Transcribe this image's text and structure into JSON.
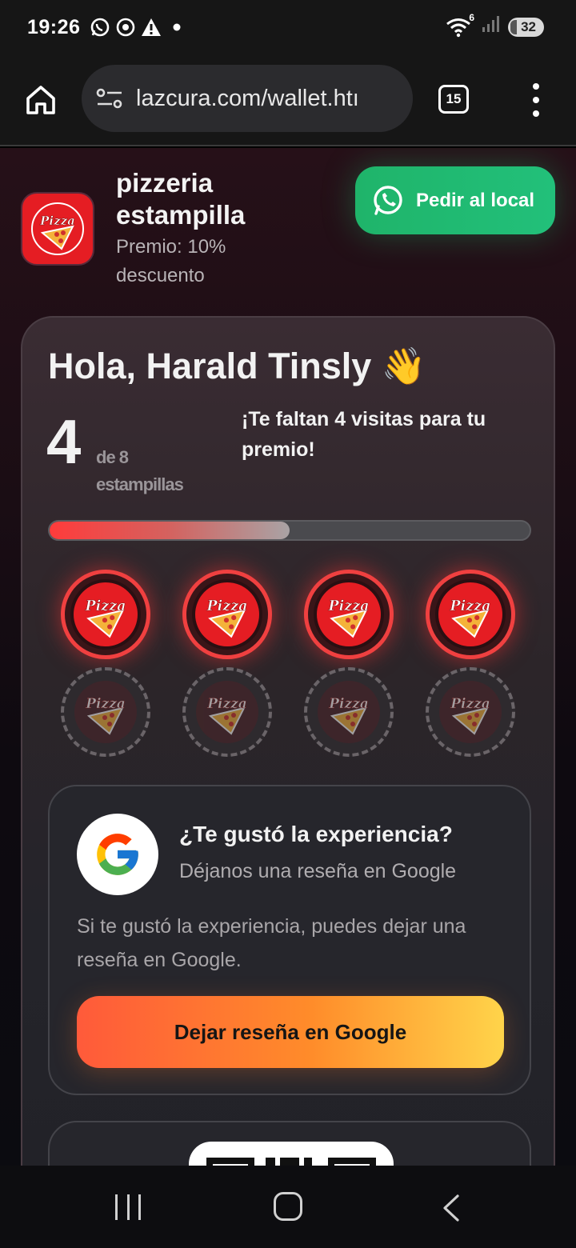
{
  "status_bar": {
    "time": "19:26",
    "notification_icons": [
      "whatsapp-icon",
      "chrome-icon",
      "warning-icon",
      "dot-icon"
    ],
    "wifi_badge": "6",
    "battery": "32"
  },
  "browser": {
    "url": "lazcura.com/wallet.htı",
    "tab_count": "15"
  },
  "shop": {
    "name": "pizzeria estampilla",
    "prize": "Premio: 10% descuento",
    "logo_text": "Pizza"
  },
  "whatsapp_button": {
    "label": "Pedir al local"
  },
  "loyalty": {
    "greeting": "Hola, Harald Tinsly 👋",
    "stamps_count": "4",
    "stamps_total_label": "de 8 estampillas",
    "remaining_message": "¡Te faltan 4 visitas para tu premio!",
    "progress_fraction": 0.5,
    "stamps_filled": 4,
    "stamps_total": 8
  },
  "review": {
    "title": "¿Te gustó la experiencia?",
    "subtitle": "Déjanos una reseña en Google",
    "body": "Si te gustó la experiencia, puedes dejar una reseña en Google.",
    "button_label": "Dejar reseña en Google"
  },
  "colors": {
    "whatsapp_green": "#22c07a",
    "stamp_red": "#e51d23",
    "review_button_gradient": [
      "#ff5a3a",
      "#ffd44a"
    ]
  }
}
